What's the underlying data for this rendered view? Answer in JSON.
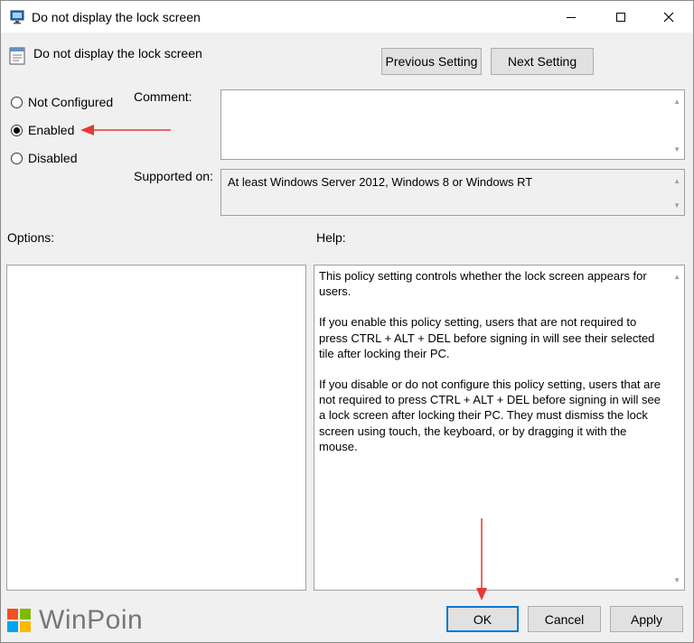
{
  "window": {
    "title": "Do not display the lock screen"
  },
  "header": {
    "policy_name": "Do not display the lock screen",
    "previous_setting": "Previous Setting",
    "next_setting": "Next Setting"
  },
  "state": {
    "options": [
      {
        "label": "Not Configured",
        "selected": false
      },
      {
        "label": "Enabled",
        "selected": true
      },
      {
        "label": "Disabled",
        "selected": false
      }
    ]
  },
  "comment": {
    "label": "Comment:",
    "value": ""
  },
  "supported": {
    "label": "Supported on:",
    "value": "At least Windows Server 2012, Windows 8 or Windows RT"
  },
  "sections": {
    "options_label": "Options:",
    "help_label": "Help:"
  },
  "help": {
    "paragraphs": [
      "This policy setting controls whether the lock screen appears for users.",
      "If you enable this policy setting, users that are not required to press CTRL + ALT + DEL before signing in will see their selected tile after locking their PC.",
      "If you disable or do not configure this policy setting, users that are not required to press CTRL + ALT + DEL before signing in will see a lock screen after locking their PC. They must dismiss the lock screen using touch, the keyboard, or by dragging it with the mouse."
    ]
  },
  "buttons": {
    "ok": "OK",
    "cancel": "Cancel",
    "apply": "Apply"
  },
  "watermark": {
    "text": "WinPoin"
  },
  "colors": {
    "annotation_arrow": "#e53935",
    "default_button_border": "#0078d7"
  }
}
